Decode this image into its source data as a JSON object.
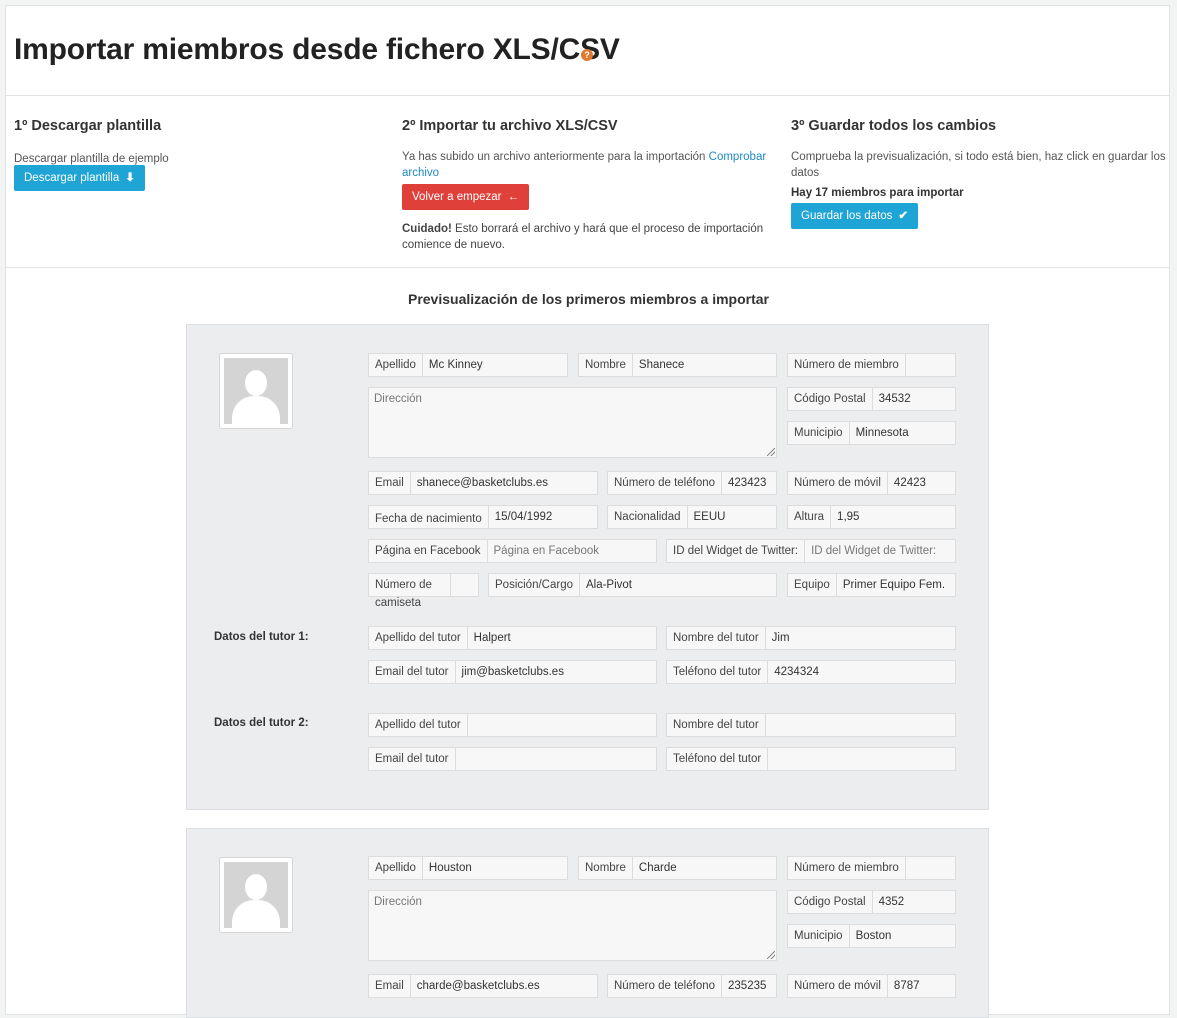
{
  "page": {
    "title": "Importar miembros desde fichero XLS/CSV",
    "help_icon": "?"
  },
  "step1": {
    "title": "1º Descargar plantilla",
    "text": "Descargar plantilla de ejemplo",
    "button": "Descargar plantilla",
    "button_icon": "download-icon"
  },
  "step2": {
    "title": "2º Importar tu archivo XLS/CSV",
    "text": "Ya has subido un archivo anteriormente para la importación",
    "link": "Comprobar archivo",
    "button": "Volver a empezar",
    "button_icon": "arrow-left-icon",
    "warning_bold": "Cuidado!",
    "warning_text": "Esto borrará el archivo y hará que el proceso de importación comience de nuevo."
  },
  "step3": {
    "title": "3º Guardar todos los cambios",
    "text": "Comprueba la previsualización, si todo está bien, haz click en guardar los datos",
    "count_text": "Hay 17 miembros para importar",
    "button": "Guardar los datos",
    "button_icon": "check-icon"
  },
  "preview": {
    "title": "Previsualización de los primeros miembros a importar"
  },
  "labels": {
    "apellido": "Apellido",
    "nombre": "Nombre",
    "numero_miembro": "Número de miembro",
    "direccion": "Dirección",
    "codigo_postal": "Código Postal",
    "municipio": "Municipio",
    "email": "Email",
    "telefono": "Número de teléfono",
    "movil": "Número de móvil",
    "nacimiento": "Fecha de nacimiento",
    "nacionalidad": "Nacionalidad",
    "altura": "Altura",
    "facebook": "Página en Facebook",
    "twitter": "ID del Widget de Twitter:",
    "camiseta": "Número de camiseta",
    "posicion": "Posición/Cargo",
    "equipo": "Equipo",
    "tutor1": "Datos del tutor 1:",
    "tutor2": "Datos del tutor 2:",
    "tutor_apellido": "Apellido del tutor",
    "tutor_nombre": "Nombre del tutor",
    "tutor_email": "Email del tutor",
    "tutor_telefono": "Teléfono del tutor"
  },
  "members": [
    {
      "apellido": "Mc Kinney",
      "nombre": "Shanece",
      "numero_miembro": "",
      "direccion": "",
      "codigo_postal": "34532",
      "municipio": "Minnesota",
      "email": "shanece@basketclubs.es",
      "telefono": "423423",
      "movil": "42423",
      "nacimiento": "15/04/1992",
      "nacionalidad": "EEUU",
      "altura": "1,95",
      "facebook": "",
      "twitter": "",
      "camiseta": "",
      "posicion": "Ala-Pivot",
      "equipo": "Primer Equipo Fem.",
      "tutor1": {
        "apellido": "Halpert",
        "nombre": "Jim",
        "email": "jim@basketclubs.es",
        "telefono": "4234324"
      },
      "tutor2": {
        "apellido": "",
        "nombre": "",
        "email": "",
        "telefono": ""
      }
    },
    {
      "apellido": "Houston",
      "nombre": "Charde",
      "numero_miembro": "",
      "direccion": "",
      "codigo_postal": "4352",
      "municipio": "Boston",
      "email": "charde@basketclubs.es",
      "telefono": "235235",
      "movil": "8787"
    }
  ]
}
